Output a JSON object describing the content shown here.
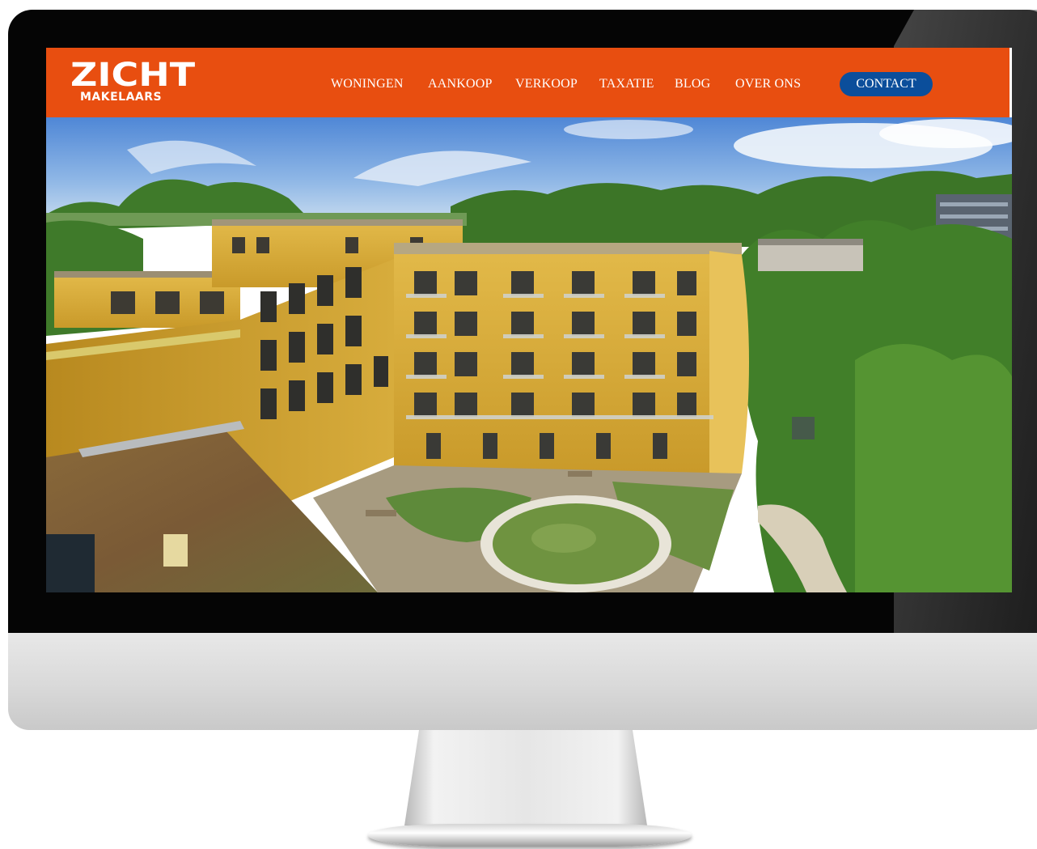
{
  "brand": {
    "name": "ZICHT",
    "subtitle": "MAKELAARS",
    "color": "#e84e10"
  },
  "nav": {
    "items": [
      {
        "label": "WONINGEN"
      },
      {
        "label": "AANKOOP"
      },
      {
        "label": "VERKOOP"
      },
      {
        "label": "TAXATIE"
      },
      {
        "label": "BLOG"
      },
      {
        "label": "OVER ONS"
      }
    ],
    "contact": {
      "label": "CONTACT",
      "color": "#0b4e9b"
    }
  },
  "hero": {
    "image": "aerial-apartment-building-photo"
  }
}
